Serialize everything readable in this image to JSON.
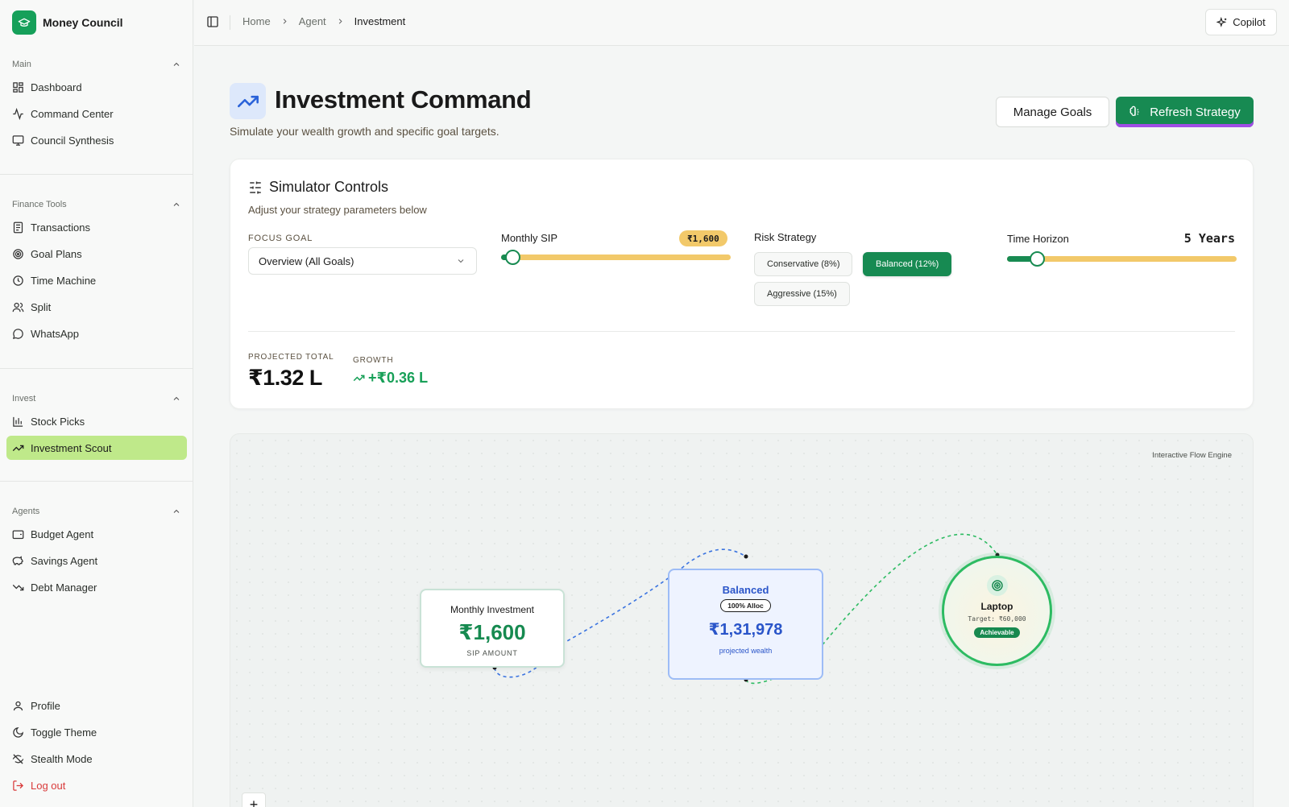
{
  "brand": {
    "name": "Money Council"
  },
  "sidebar": {
    "main": {
      "heading": "Main",
      "items": [
        {
          "label": "Dashboard",
          "icon": "dashboard-icon"
        },
        {
          "label": "Command Center",
          "icon": "activity-icon"
        },
        {
          "label": "Council Synthesis",
          "icon": "monitor-icon"
        }
      ]
    },
    "finance": {
      "heading": "Finance Tools",
      "items": [
        {
          "label": "Transactions",
          "icon": "receipt-icon"
        },
        {
          "label": "Goal Plans",
          "icon": "target-icon"
        },
        {
          "label": "Time Machine",
          "icon": "clock-icon"
        },
        {
          "label": "Split",
          "icon": "users-icon"
        },
        {
          "label": "WhatsApp",
          "icon": "chat-bubble-icon"
        }
      ]
    },
    "invest": {
      "heading": "Invest",
      "items": [
        {
          "label": "Stock Picks",
          "icon": "bar-chart-icon"
        },
        {
          "label": "Investment Scout",
          "icon": "trending-up-icon",
          "active": true
        }
      ]
    },
    "agents": {
      "heading": "Agents",
      "items": [
        {
          "label": "Budget Agent",
          "icon": "wallet-icon"
        },
        {
          "label": "Savings Agent",
          "icon": "piggy-bank-icon"
        },
        {
          "label": "Debt Manager",
          "icon": "trending-down-icon"
        }
      ]
    },
    "footer": {
      "items": [
        {
          "label": "Profile",
          "icon": "user-icon"
        },
        {
          "label": "Toggle Theme",
          "icon": "moon-icon"
        },
        {
          "label": "Stealth Mode",
          "icon": "eye-off-icon"
        },
        {
          "label": "Log out",
          "icon": "logout-icon"
        }
      ]
    }
  },
  "topbar": {
    "breadcrumb": [
      "Home",
      "Agent",
      "Investment"
    ],
    "copilot_label": "Copilot"
  },
  "header": {
    "title": "Investment Command",
    "subtitle": "Simulate your wealth growth and specific goal targets.",
    "manage_goals_label": "Manage Goals",
    "refresh_label": "Refresh Strategy"
  },
  "simulator": {
    "title": "Simulator Controls",
    "subtitle": "Adjust your strategy parameters below",
    "focus_goal": {
      "label": "FOCUS GOAL",
      "value": "Overview (All Goals)"
    },
    "monthly_sip": {
      "label": "Monthly SIP",
      "value": "₹1,600",
      "fill_fraction": 0.05
    },
    "risk": {
      "label": "Risk Strategy",
      "options": [
        "Conservative (8%)",
        "Balanced (12%)",
        "Aggressive (15%)"
      ],
      "selected": "Balanced (12%)"
    },
    "time_horizon": {
      "label": "Time Horizon",
      "value": "5 Years",
      "fill_fraction": 0.13
    },
    "projected_total": {
      "label": "PROJECTED TOTAL",
      "value": "₹1.32 L"
    },
    "growth": {
      "label": "GROWTH",
      "value": "+₹0.36 L"
    }
  },
  "flow": {
    "tag": "Interactive Flow Engine",
    "monthly": {
      "title": "Monthly Investment",
      "value": "₹1,600",
      "sub": "SIP AMOUNT"
    },
    "balanced": {
      "title": "Balanced",
      "badge": "100% Alloc",
      "value": "₹1,31,978",
      "sub": "projected wealth"
    },
    "goal": {
      "title": "Laptop",
      "target": "Target: ₹60,000",
      "status": "Achievable"
    },
    "zoom_in_label": "+"
  },
  "colors": {
    "accent": "#178a52",
    "active_nav": "#bfe98a",
    "slider_track": "#f2c96a",
    "balanced_blue": "#2a55c9",
    "goal_green": "#2dbb62",
    "logout_red": "#d93a3a"
  }
}
